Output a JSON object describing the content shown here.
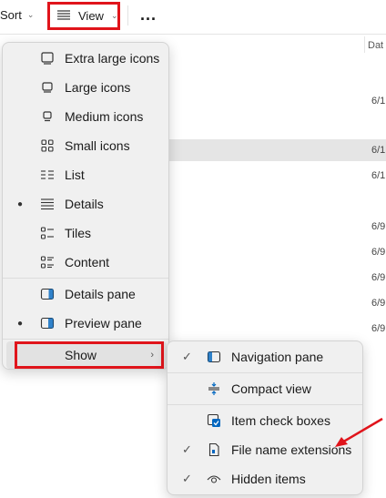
{
  "toolbar": {
    "sort_label": "Sort",
    "view_label": "View",
    "more_label": "..."
  },
  "list": {
    "date_header": "Dat",
    "dates": [
      "6/1",
      "6/1",
      "6/1",
      "6/9",
      "6/9",
      "6/9",
      "6/9",
      "6/9"
    ]
  },
  "menu": {
    "items": [
      {
        "label": "Extra large icons",
        "icon": "monitor-large-icon",
        "selected": false
      },
      {
        "label": "Large icons",
        "icon": "monitor-icon",
        "selected": false
      },
      {
        "label": "Medium icons",
        "icon": "monitor-small-icon",
        "selected": false
      },
      {
        "label": "Small icons",
        "icon": "grid-icon",
        "selected": false
      },
      {
        "label": "List",
        "icon": "list-icon",
        "selected": false
      },
      {
        "label": "Details",
        "icon": "details-icon",
        "selected": true
      },
      {
        "label": "Tiles",
        "icon": "tiles-icon",
        "selected": false
      },
      {
        "label": "Content",
        "icon": "content-icon",
        "selected": false
      }
    ],
    "panes": [
      {
        "label": "Details pane",
        "icon": "details-pane-icon",
        "selected": false
      },
      {
        "label": "Preview pane",
        "icon": "preview-pane-icon",
        "selected": true
      }
    ],
    "show_label": "Show"
  },
  "submenu": {
    "items": [
      {
        "label": "Navigation pane",
        "icon": "navigation-pane-icon",
        "checked": true
      },
      {
        "label": "Compact view",
        "icon": "compact-view-icon",
        "checked": false
      },
      {
        "label": "Item check boxes",
        "icon": "checkbox-icon",
        "checked": false
      },
      {
        "label": "File name extensions",
        "icon": "file-icon",
        "checked": true
      },
      {
        "label": "Hidden items",
        "icon": "eye-icon",
        "checked": true
      }
    ]
  },
  "colors": {
    "highlight_red": "#e0141b",
    "accent_blue": "#0067c0"
  }
}
